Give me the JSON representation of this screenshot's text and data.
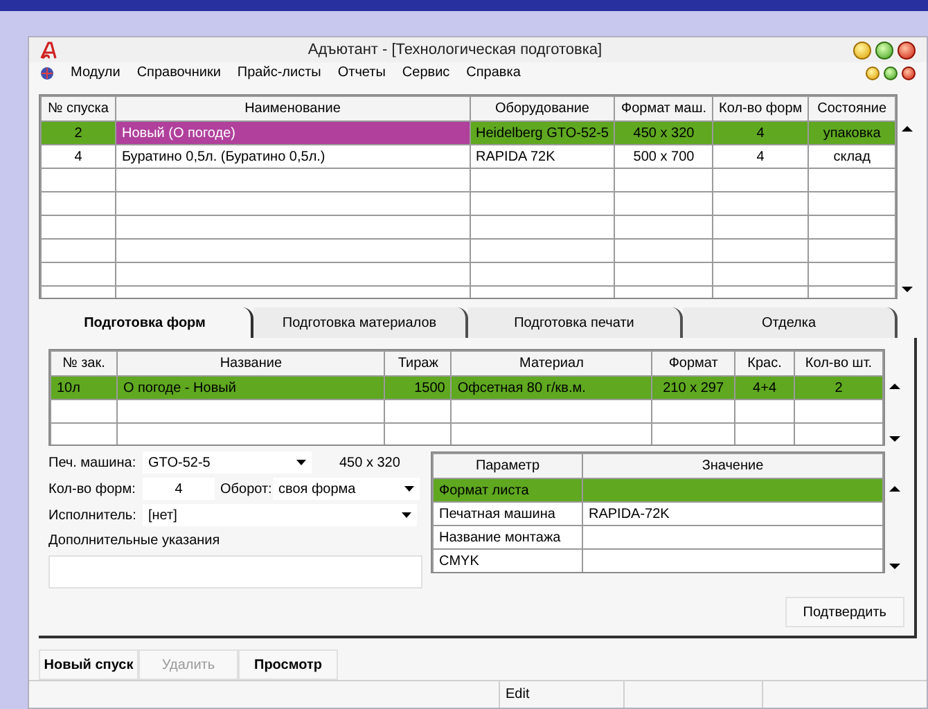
{
  "window": {
    "title": "Адъютант - [Технологическая подготовка]"
  },
  "menu": [
    "Модули",
    "Справочники",
    "Прайс-листы",
    "Отчеты",
    "Сервис",
    "Справка"
  ],
  "top_table": {
    "columns": [
      "№ спуска",
      "Наименование",
      "Оборудование",
      "Формат маш.",
      "Кол-во форм",
      "Состояние"
    ],
    "rows": [
      {
        "cells": [
          "2",
          "Новый (О погоде)",
          "Heidelberg GTO-52-5",
          "450 x 320",
          "4",
          "упаковка"
        ],
        "selected": true,
        "marked": true
      },
      {
        "cells": [
          "4",
          "Буратино 0,5л. (Буратино 0,5л.)",
          "RAPIDA 72K",
          "500 x 700",
          "4",
          "склад"
        ],
        "selected": false,
        "marked": false
      }
    ]
  },
  "tabs": [
    {
      "label": "Подготовка форм",
      "selected": true
    },
    {
      "label": "Подготовка материалов",
      "selected": false
    },
    {
      "label": "Подготовка печати",
      "selected": false
    },
    {
      "label": "Отделка",
      "selected": false
    }
  ],
  "order_table": {
    "columns": [
      "№ зак.",
      "Название",
      "Тираж",
      "Материал",
      "Формат",
      "Крас.",
      "Кол-во шт."
    ],
    "rows": [
      {
        "cells": [
          "10л",
          "О погоде - Новый",
          "1500",
          "Офсетная 80 г/кв.м.",
          "210 x 297",
          "4+4",
          "2"
        ],
        "selected": true
      }
    ]
  },
  "form": {
    "press_label": "Печ. машина:",
    "press_value": "GTO-52-5",
    "press_format": "450 x 320",
    "forms_label": "Кол-во форм:",
    "forms_value": "4",
    "turn_label": "Оборот:",
    "turn_value": "своя форма",
    "executor_label": "Исполнитель:",
    "executor_value": "[нет]",
    "notes_label": "Дополнительные указания"
  },
  "param_table": {
    "columns": [
      "Параметр",
      "Значение"
    ],
    "rows": [
      {
        "cells": [
          "Формат листа",
          ""
        ],
        "selected": true
      },
      {
        "cells": [
          "Печатная машина",
          "RAPIDA-72K"
        ],
        "selected": false
      },
      {
        "cells": [
          "Название монтажа",
          ""
        ],
        "selected": false
      },
      {
        "cells": [
          "CMYK",
          ""
        ],
        "selected": false
      }
    ]
  },
  "confirm_button": "Подтвердить",
  "bottom_buttons": [
    {
      "label": "Новый спуск",
      "disabled": false
    },
    {
      "label": "Удалить",
      "disabled": true
    },
    {
      "label": "Просмотр",
      "disabled": false
    }
  ],
  "status_bar": {
    "mode": "Edit"
  }
}
